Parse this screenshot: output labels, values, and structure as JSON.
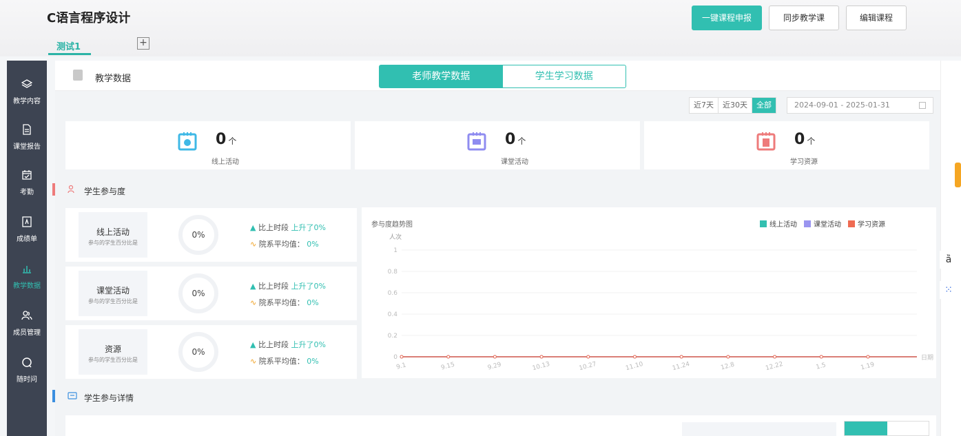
{
  "header": {
    "course_title": "C语言程序设计",
    "tab": "测试1",
    "add_tab": "+",
    "btn_submit": "一键课程申报",
    "btn_sync": "同步教学课",
    "btn_edit": "编辑课程"
  },
  "sidebar": {
    "items": [
      {
        "label": "教学内容",
        "icon": "layers-icon"
      },
      {
        "label": "课堂报告",
        "icon": "document-icon"
      },
      {
        "label": "考勤",
        "icon": "calendar-check-icon"
      },
      {
        "label": "成绩单",
        "icon": "grade-icon"
      },
      {
        "label": "教学数据",
        "icon": "bar-chart-icon"
      },
      {
        "label": "成员管理",
        "icon": "members-icon"
      },
      {
        "label": "随时问",
        "icon": "question-icon"
      }
    ],
    "active": "教学数据"
  },
  "panel": {
    "title": "教学数据",
    "seg_teacher": "老师教学数据",
    "seg_student": "学生学习数据",
    "range_7": "近7天",
    "range_30": "近30天",
    "range_all": "全部",
    "date_range": "2024-09-01 - 2025-01-31"
  },
  "stats": [
    {
      "value": "0",
      "unit": "个",
      "label": "线上活动",
      "color": "#3fb8e6"
    },
    {
      "value": "0",
      "unit": "个",
      "label": "课堂活动",
      "color": "#8f8cf0"
    },
    {
      "value": "0",
      "unit": "个",
      "label": "学习资源",
      "color": "#ee7b7b"
    }
  ],
  "participation": {
    "title": "学生参与度",
    "rows": [
      {
        "name": "线上活动",
        "sub": "参与的学生百分比是",
        "pct": "0%",
        "cmp_label": "比上时段",
        "cmp_value": "上升了0%",
        "avg_label": "院系平均值：",
        "avg_value": "0%"
      },
      {
        "name": "课堂活动",
        "sub": "参与的学生百分比是",
        "pct": "0%",
        "cmp_label": "比上时段",
        "cmp_value": "上升了0%",
        "avg_label": "院系平均值：",
        "avg_value": "0%"
      },
      {
        "name": "资源",
        "sub": "参与的学生百分比是",
        "pct": "0%",
        "cmp_label": "比上时段",
        "cmp_value": "上升了0%",
        "avg_label": "院系平均值：",
        "avg_value": "0%"
      }
    ]
  },
  "detail": {
    "title": "学生参与详情"
  },
  "chart_data": {
    "type": "line",
    "title": "参与度趋势图",
    "ylabel": "人次",
    "xlabel": "日期",
    "ylim": [
      0,
      1
    ],
    "yticks": [
      "0",
      "0.2",
      "0.4",
      "0.6",
      "0.8",
      "1"
    ],
    "categories": [
      "9.1",
      "9.15",
      "9.29",
      "10.13",
      "10.27",
      "11.10",
      "11.24",
      "12.8",
      "12.22",
      "1.5",
      "1.19"
    ],
    "series": [
      {
        "name": "线上活动",
        "color": "#33bfb0",
        "values": [
          0,
          0,
          0,
          0,
          0,
          0,
          0,
          0,
          0,
          0,
          0
        ]
      },
      {
        "name": "课堂活动",
        "color": "#9a95f0",
        "values": [
          0,
          0,
          0,
          0,
          0,
          0,
          0,
          0,
          0,
          0,
          0
        ]
      },
      {
        "name": "学习资源",
        "color": "#ef6b52",
        "values": [
          0,
          0,
          0,
          0,
          0,
          0,
          0,
          0,
          0,
          0,
          0
        ]
      }
    ],
    "legend": "top-right"
  }
}
